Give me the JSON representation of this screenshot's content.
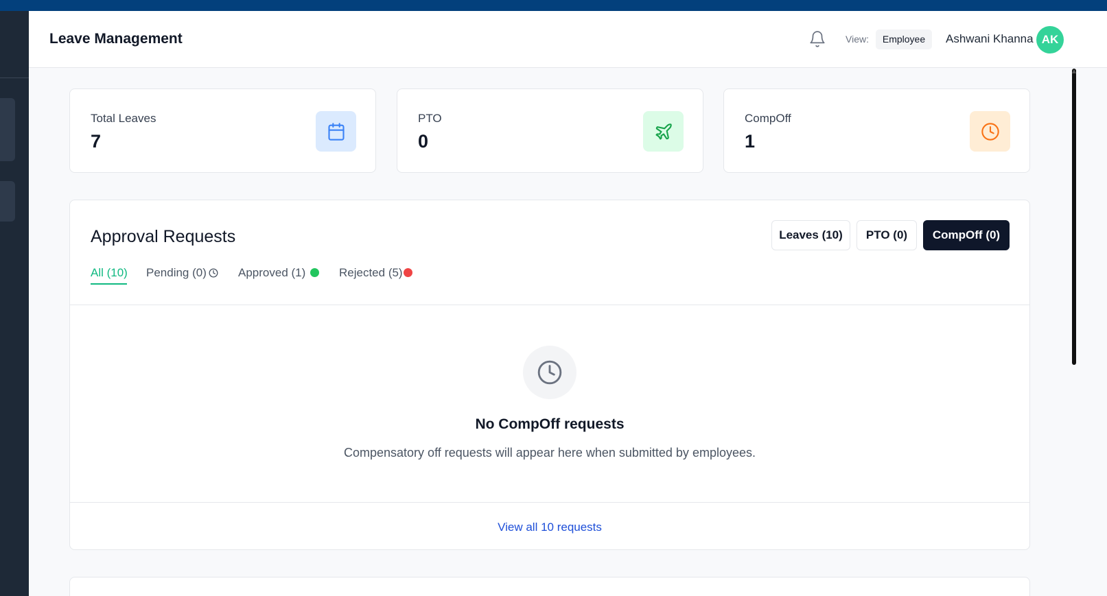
{
  "header": {
    "app_title": "Leave Management",
    "view_label": "View:",
    "view_value": "Employee",
    "user_name": "Ashwani Khanna",
    "avatar_initials": "AK",
    "bell_icon": "bell-icon"
  },
  "stats": [
    {
      "label": "Total Leaves",
      "value": "7",
      "icon": "calendar-icon",
      "icon_color": "#3b82f6",
      "icon_bg": "#dbeafe"
    },
    {
      "label": "PTO",
      "value": "0",
      "icon": "plane-icon",
      "icon_color": "#16a34a",
      "icon_bg": "#dcfce7"
    },
    {
      "label": "CompOff",
      "value": "1",
      "icon": "clock-icon",
      "icon_color": "#f97316",
      "icon_bg": "#ffedd5"
    }
  ],
  "approvals": {
    "title": "Approval Requests",
    "type_buttons": [
      {
        "label": "Leaves (10)",
        "active": false
      },
      {
        "label": "PTO (0)",
        "active": false
      },
      {
        "label": "CompOff (0)",
        "active": true
      }
    ],
    "status_tabs": [
      {
        "label": "All (10)",
        "active": true
      },
      {
        "label": "Pending (0)",
        "indicator": "clock-icon"
      },
      {
        "label": "Approved (1)",
        "indicator": "green-dot",
        "color": "#22c55e"
      },
      {
        "label": "Rejected (5)",
        "indicator": "red-dot",
        "color": "#ef4444"
      }
    ],
    "empty_state": {
      "icon": "clock-icon",
      "title": "No CompOff requests",
      "description": "Compensatory off requests will appear here when submitted by employees."
    },
    "view_all_label": "View all 10 requests"
  },
  "colors": {
    "topbar": "#03407c",
    "sidebar": "#1e2937",
    "accent_green": "#10b981",
    "link_blue": "#1d4ed8",
    "active_button": "#0f172a"
  }
}
